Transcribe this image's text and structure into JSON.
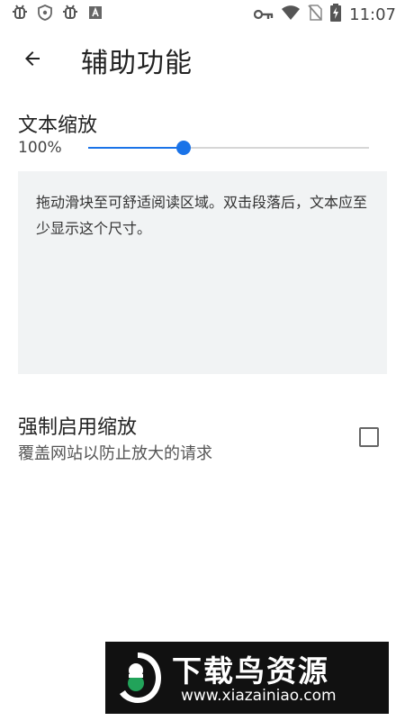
{
  "status_bar": {
    "time": "11:07",
    "left_icons": [
      "bug-icon",
      "shield-icon",
      "bug-icon",
      "text-box-icon"
    ],
    "right_icons": [
      "key-icon",
      "wifi-icon",
      "no-sim-icon",
      "battery-charging-icon"
    ]
  },
  "app_bar": {
    "title": "辅助功能",
    "back_icon": "arrow-back-icon"
  },
  "text_scaling": {
    "title": "文本缩放",
    "value_label": "100%",
    "slider_fraction": 0.34,
    "accent_color": "#1a73e8",
    "preview_text": "拖动滑块至可舒适阅读区域。双击段落后，文本应至少显示这个尺寸。"
  },
  "force_zoom": {
    "title": "强制启用缩放",
    "description": "覆盖网站以防止放大的请求",
    "checked": false
  },
  "watermark": {
    "title": "下载鸟资源",
    "url": "www.xiazainiao.com"
  }
}
